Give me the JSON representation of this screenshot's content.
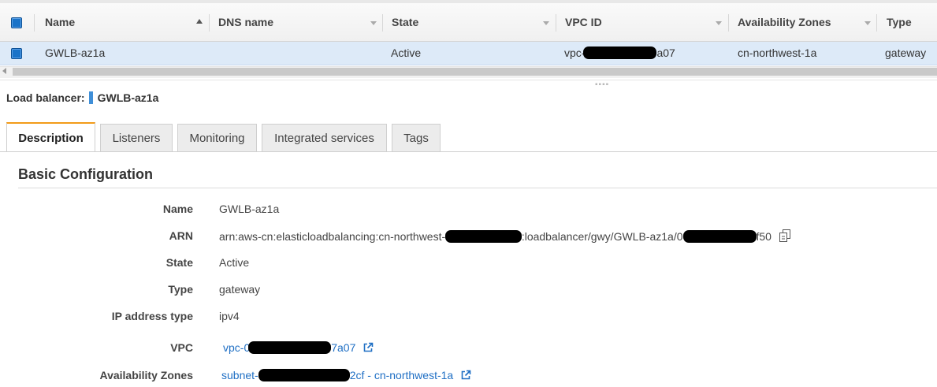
{
  "grid": {
    "columns": [
      {
        "key": "name",
        "label": "Name"
      },
      {
        "key": "dns",
        "label": "DNS name"
      },
      {
        "key": "state",
        "label": "State"
      },
      {
        "key": "vpc",
        "label": "VPC ID"
      },
      {
        "key": "az",
        "label": "Availability Zones"
      },
      {
        "key": "type",
        "label": "Type"
      }
    ],
    "row": {
      "name": "GWLB-az1a",
      "dns": "",
      "state": "Active",
      "vpc_prefix": "vpc-",
      "vpc_suffix": "a07",
      "az": "cn-northwest-1a",
      "type": "gateway"
    },
    "drag_handle": "▪▪▪▪"
  },
  "load_balancer": {
    "label": "Load balancer:",
    "name": "GWLB-az1a"
  },
  "tabs": [
    {
      "label": "Description",
      "active": true
    },
    {
      "label": "Listeners",
      "active": false
    },
    {
      "label": "Monitoring",
      "active": false
    },
    {
      "label": "Integrated services",
      "active": false
    },
    {
      "label": "Tags",
      "active": false
    }
  ],
  "description": {
    "section_title": "Basic Configuration",
    "fields": {
      "name": {
        "label": "Name",
        "value": "GWLB-az1a"
      },
      "arn": {
        "label": "ARN",
        "value_prefix": "arn:aws-cn:elasticloadbalancing:cn-northwest-1:",
        "value_middle": ":loadbalancer/gwy/GWLB-az1a/0",
        "value_suffix": "f50"
      },
      "state": {
        "label": "State",
        "value": "Active"
      },
      "type": {
        "label": "Type",
        "value": "gateway"
      },
      "ip_address_type": {
        "label": "IP address type",
        "value": "ipv4"
      },
      "vpc": {
        "label": "VPC",
        "value_prefix": "vpc-0",
        "value_suffix": "7a07"
      },
      "availability_zones": {
        "label": "Availability Zones",
        "value_prefix": "subnet-",
        "value_suffix": "2cf - cn-northwest-1a"
      }
    }
  },
  "colors": {
    "accent_tab": "#f29b1a",
    "link": "#1f6fc4",
    "selected_row": "#ddeaf8",
    "checkbox": "#1a73c8"
  },
  "icons": [
    "checkbox-icon",
    "sort-asc-icon",
    "sort-desc-icon",
    "copy-icon",
    "external-link-icon",
    "scroll-left-arrow-icon"
  ]
}
